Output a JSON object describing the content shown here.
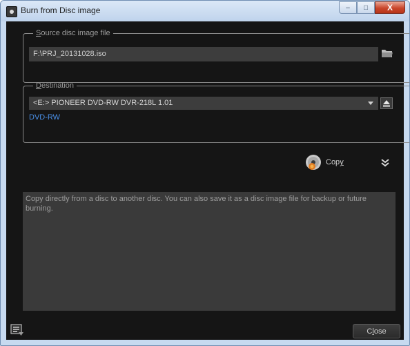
{
  "window": {
    "title": "Burn from Disc image",
    "controls": {
      "minimize": "–",
      "maximize": "□",
      "close": "X"
    }
  },
  "source": {
    "legend_prefix": "S",
    "legend_rest": "ource disc image file",
    "path": "F:\\PRJ_20131028.iso",
    "browse_icon": "folder-icon"
  },
  "destination": {
    "legend_prefix": "D",
    "legend_rest": "estination",
    "drive": "<E:> PIONEER DVD-RW  DVR-218L 1.01",
    "disc_type": "DVD-RW",
    "eject_icon": "eject-icon"
  },
  "actions": {
    "copy_label_prefix": "Cop",
    "copy_label_underlined": "y",
    "copy_icon": "disc-copy-icon",
    "expand_icon": "double-chevron-down-icon"
  },
  "description": "Copy directly from a disc to another disc. You can also save it as a disc image file for backup or future burning.",
  "footer": {
    "log_icon": "log-list-icon",
    "close_prefix": "C",
    "close_underlined": "l",
    "close_rest": "ose"
  },
  "colors": {
    "background": "#151515",
    "field": "#3d3d3d",
    "accent_link": "#4a90e8"
  }
}
